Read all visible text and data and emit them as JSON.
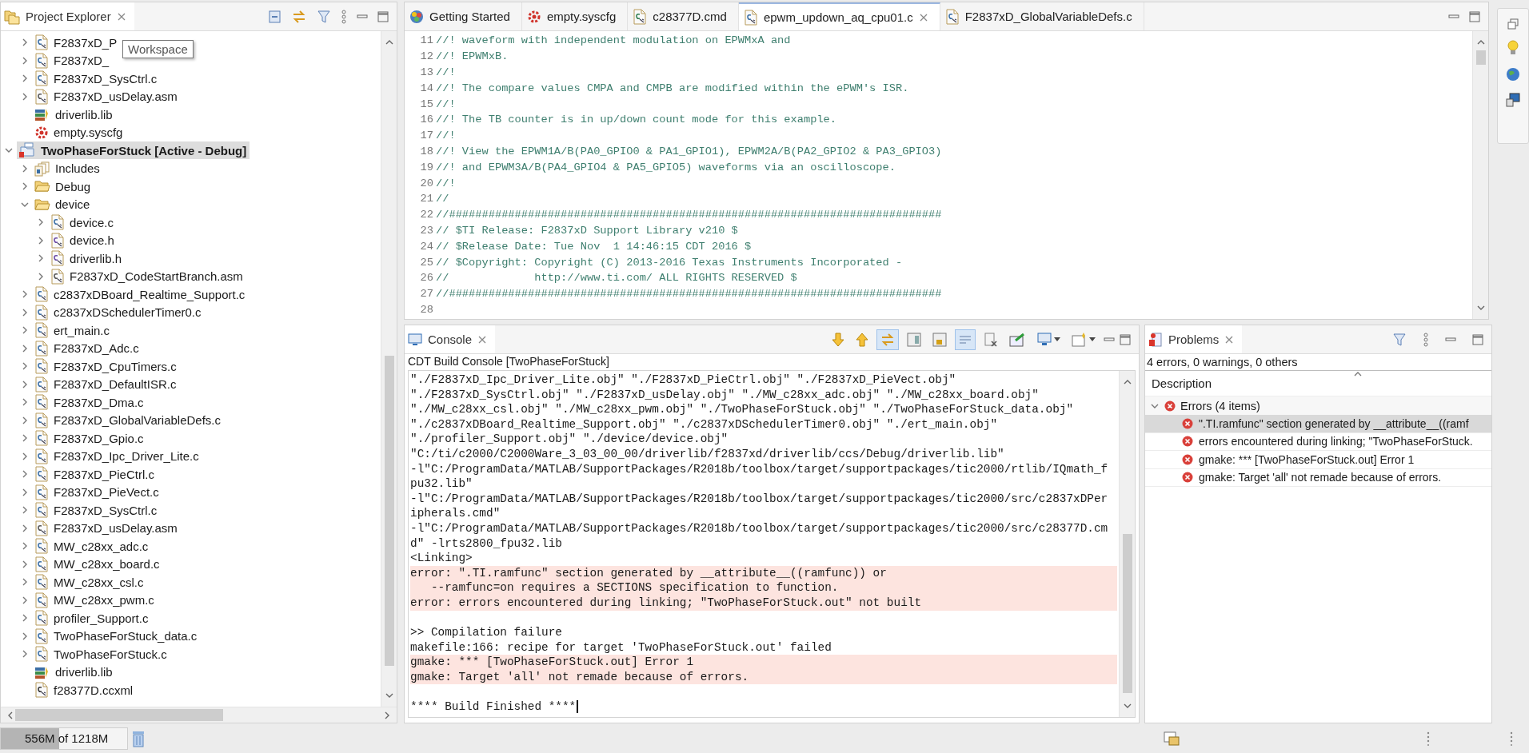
{
  "explorer": {
    "title": "Project Explorer",
    "tooltip": "Workspace",
    "continued_items": [
      {
        "label": "F2837xD_P",
        "kind": "c-file",
        "expanded": false,
        "selected": false
      },
      {
        "label": "F2837xD_",
        "kind": "c-file",
        "expanded": false,
        "selected": false
      },
      {
        "label": "F2837xD_SysCtrl.c",
        "kind": "c-file",
        "expanded": false,
        "selected": false
      },
      {
        "label": "F2837xD_usDelay.asm",
        "kind": "asm-file",
        "expanded": false,
        "selected": false
      },
      {
        "label": "driverlib.lib",
        "kind": "library",
        "selected": false
      },
      {
        "label": "empty.syscfg",
        "kind": "syscfg",
        "selected": false
      }
    ],
    "tree": [
      {
        "label": "TwoPhaseForStuck  [Active - Debug]",
        "kind": "project",
        "expanded": true,
        "selected": true,
        "children": [
          {
            "label": "Includes",
            "kind": "includes",
            "expanded": false,
            "selected": false
          },
          {
            "label": "Debug",
            "kind": "folder",
            "expanded": false,
            "selected": false
          },
          {
            "label": "device",
            "kind": "folder",
            "expanded": true,
            "selected": false,
            "children": [
              {
                "label": "device.c",
                "kind": "c-file",
                "expanded": false,
                "selected": false
              },
              {
                "label": "device.h",
                "kind": "h-file",
                "expanded": false,
                "selected": false
              },
              {
                "label": "driverlib.h",
                "kind": "h-file",
                "expanded": false,
                "selected": false
              },
              {
                "label": "F2837xD_CodeStartBranch.asm",
                "kind": "asm-file",
                "expanded": false,
                "selected": false
              }
            ]
          },
          {
            "label": "c2837xDBoard_Realtime_Support.c",
            "kind": "c-file",
            "expanded": false,
            "selected": false
          },
          {
            "label": "c2837xDSchedulerTimer0.c",
            "kind": "c-file",
            "expanded": false,
            "selected": false
          },
          {
            "label": "ert_main.c",
            "kind": "c-file",
            "expanded": false,
            "selected": false
          },
          {
            "label": "F2837xD_Adc.c",
            "kind": "c-file",
            "expanded": false,
            "selected": false
          },
          {
            "label": "F2837xD_CpuTimers.c",
            "kind": "c-file",
            "expanded": false,
            "selected": false
          },
          {
            "label": "F2837xD_DefaultISR.c",
            "kind": "c-file",
            "expanded": false,
            "selected": false
          },
          {
            "label": "F2837xD_Dma.c",
            "kind": "c-file",
            "expanded": false,
            "selected": false
          },
          {
            "label": "F2837xD_GlobalVariableDefs.c",
            "kind": "c-file",
            "expanded": false,
            "selected": false
          },
          {
            "label": "F2837xD_Gpio.c",
            "kind": "c-file",
            "expanded": false,
            "selected": false
          },
          {
            "label": "F2837xD_Ipc_Driver_Lite.c",
            "kind": "c-file",
            "expanded": false,
            "selected": false
          },
          {
            "label": "F2837xD_PieCtrl.c",
            "kind": "c-file",
            "expanded": false,
            "selected": false
          },
          {
            "label": "F2837xD_PieVect.c",
            "kind": "c-file",
            "expanded": false,
            "selected": false
          },
          {
            "label": "F2837xD_SysCtrl.c",
            "kind": "c-file",
            "expanded": false,
            "selected": false
          },
          {
            "label": "F2837xD_usDelay.asm",
            "kind": "asm-file",
            "expanded": false,
            "selected": false
          },
          {
            "label": "MW_c28xx_adc.c",
            "kind": "c-file",
            "expanded": false,
            "selected": false
          },
          {
            "label": "MW_c28xx_board.c",
            "kind": "c-file",
            "expanded": false,
            "selected": false
          },
          {
            "label": "MW_c28xx_csl.c",
            "kind": "c-file",
            "expanded": false,
            "selected": false
          },
          {
            "label": "MW_c28xx_pwm.c",
            "kind": "c-file",
            "expanded": false,
            "selected": false
          },
          {
            "label": "profiler_Support.c",
            "kind": "c-file",
            "expanded": false,
            "selected": false
          },
          {
            "label": "TwoPhaseForStuck_data.c",
            "kind": "c-file",
            "expanded": false,
            "selected": false
          },
          {
            "label": "TwoPhaseForStuck.c",
            "kind": "c-file",
            "expanded": false,
            "selected": false
          },
          {
            "label": "driverlib.lib",
            "kind": "library",
            "selected": false
          },
          {
            "label": "f28377D.ccxml",
            "kind": "ccxml",
            "selected": false
          }
        ]
      }
    ]
  },
  "editor": {
    "tabs": [
      {
        "label": "Getting Started",
        "kind": "welcome",
        "selected": false
      },
      {
        "label": "empty.syscfg",
        "kind": "syscfg",
        "selected": false
      },
      {
        "label": "c28377D.cmd",
        "kind": "cmd-file",
        "selected": false
      },
      {
        "label": "epwm_updown_aq_cpu01.c",
        "kind": "c-file",
        "selected": true
      },
      {
        "label": "F2837xD_GlobalVariableDefs.c",
        "kind": "c-file",
        "selected": false
      }
    ],
    "lines": [
      {
        "number": "11",
        "text": "//! waveform with independent modulation on EPWMxA and"
      },
      {
        "number": "12",
        "text": "//! EPWMxB."
      },
      {
        "number": "13",
        "text": "//!"
      },
      {
        "number": "14",
        "text": "//! The compare values CMPA and CMPB are modified within the ePWM's ISR."
      },
      {
        "number": "15",
        "text": "//!"
      },
      {
        "number": "16",
        "text": "//! The TB counter is in up/down count mode for this example."
      },
      {
        "number": "17",
        "text": "//!"
      },
      {
        "number": "18",
        "text": "//! View the EPWM1A/B(PA0_GPIO0 & PA1_GPIO1), EPWM2A/B(PA2_GPIO2 & PA3_GPIO3)"
      },
      {
        "number": "19",
        "text": "//! and EPWM3A/B(PA4_GPIO4 & PA5_GPIO5) waveforms via an oscilloscope."
      },
      {
        "number": "20",
        "text": "//!"
      },
      {
        "number": "21",
        "text": "//"
      },
      {
        "number": "22",
        "text": "//###########################################################################"
      },
      {
        "number": "23",
        "text": "// $TI Release: F2837xD Support Library v210 $"
      },
      {
        "number": "24",
        "text": "// $Release Date: Tue Nov  1 14:46:15 CDT 2016 $"
      },
      {
        "number": "25",
        "text": "// $Copyright: Copyright (C) 2013-2016 Texas Instruments Incorporated -"
      },
      {
        "number": "26",
        "text": "//             http://www.ti.com/ ALL RIGHTS RESERVED $"
      },
      {
        "number": "27",
        "text": "//###########################################################################"
      },
      {
        "number": "28"
      }
    ]
  },
  "console": {
    "title": "Console",
    "subtitle": "CDT Build Console [TwoPhaseForStuck]",
    "toolbar": [
      {
        "kind": "arrow-down",
        "pressed": false
      },
      {
        "kind": "arrow-up",
        "pressed": false
      },
      {
        "kind": "swap",
        "pressed": true
      },
      {
        "kind": "window-a",
        "pressed": false
      },
      {
        "kind": "window-lock",
        "pressed": false
      },
      {
        "kind": "lines",
        "pressed": true
      },
      {
        "kind": "clear",
        "pressed": false
      },
      {
        "kind": "pin",
        "pressed": false
      },
      {
        "kind": "monitor-menu",
        "pressed": false
      },
      {
        "kind": "new-menu",
        "pressed": false
      }
    ],
    "lines": [
      {
        "kind": "output",
        "text": "\"./F2837xD_Ipc_Driver_Lite.obj\" \"./F2837xD_PieCtrl.obj\" \"./F2837xD_PieVect.obj\""
      },
      {
        "kind": "output",
        "text": "\"./F2837xD_SysCtrl.obj\" \"./F2837xD_usDelay.obj\" \"./MW_c28xx_adc.obj\" \"./MW_c28xx_board.obj\""
      },
      {
        "kind": "output",
        "text": "\"./MW_c28xx_csl.obj\" \"./MW_c28xx_pwm.obj\" \"./TwoPhaseForStuck.obj\" \"./TwoPhaseForStuck_data.obj\""
      },
      {
        "kind": "output",
        "text": "\"./c2837xDBoard_Realtime_Support.obj\" \"./c2837xDSchedulerTimer0.obj\" \"./ert_main.obj\""
      },
      {
        "kind": "output",
        "text": "\"./profiler_Support.obj\" \"./device/device.obj\""
      },
      {
        "kind": "output",
        "text": "\"C:/ti/c2000/C2000Ware_3_03_00_00/driverlib/f2837xd/driverlib/ccs/Debug/driverlib.lib\""
      },
      {
        "kind": "output",
        "text": "-l\"C:/ProgramData/MATLAB/SupportPackages/R2018b/toolbox/target/supportpackages/tic2000/rtlib/IQmath_f"
      },
      {
        "kind": "output",
        "text": "pu32.lib\""
      },
      {
        "kind": "output",
        "text": "-l\"C:/ProgramData/MATLAB/SupportPackages/R2018b/toolbox/target/supportpackages/tic2000/src/c2837xDPer"
      },
      {
        "kind": "output",
        "text": "ipherals.cmd\""
      },
      {
        "kind": "output",
        "text": "-l\"C:/ProgramData/MATLAB/SupportPackages/R2018b/toolbox/target/supportpackages/tic2000/src/c28377D.cm"
      },
      {
        "kind": "output",
        "text": "d\" -lrts2800_fpu32.lib"
      },
      {
        "kind": "output",
        "text": "<Linking>"
      },
      {
        "kind": "error",
        "text": "error: \".TI.ramfunc\" section generated by __attribute__((ramfunc)) or"
      },
      {
        "kind": "error",
        "text": "   --ramfunc=on requires a SECTIONS specification to function."
      },
      {
        "kind": "error",
        "text": "error: errors encountered during linking; \"TwoPhaseForStuck.out\" not built"
      },
      {
        "kind": "blank"
      },
      {
        "kind": "output",
        "text": ">> Compilation failure"
      },
      {
        "kind": "output",
        "text": "makefile:166: recipe for target 'TwoPhaseForStuck.out' failed"
      },
      {
        "kind": "error",
        "text": "gmake: *** [TwoPhaseForStuck.out] Error 1"
      },
      {
        "kind": "error",
        "text": "gmake: Target 'all' not remade because of errors."
      },
      {
        "kind": "blank"
      },
      {
        "kind": "output",
        "text": "**** Build Finished ****",
        "cursor": true
      }
    ]
  },
  "problems": {
    "title": "Problems",
    "summary": "4 errors, 0 warnings, 0 others",
    "column": "Description",
    "groups": [
      {
        "label": "Errors (4 items)",
        "expanded": true,
        "items": [
          {
            "text": "\".TI.ramfunc\" section generated by __attribute__((ramf",
            "selected": true
          },
          {
            "text": "errors encountered during linking; \"TwoPhaseForStuck.",
            "selected": false
          },
          {
            "text": "gmake: *** [TwoPhaseForStuck.out] Error 1",
            "selected": false
          },
          {
            "text": "gmake: Target 'all' not remade because of errors.",
            "selected": false
          }
        ]
      }
    ]
  },
  "status_bar": {
    "memory": "556M of 1218M",
    "level": 0.46
  }
}
